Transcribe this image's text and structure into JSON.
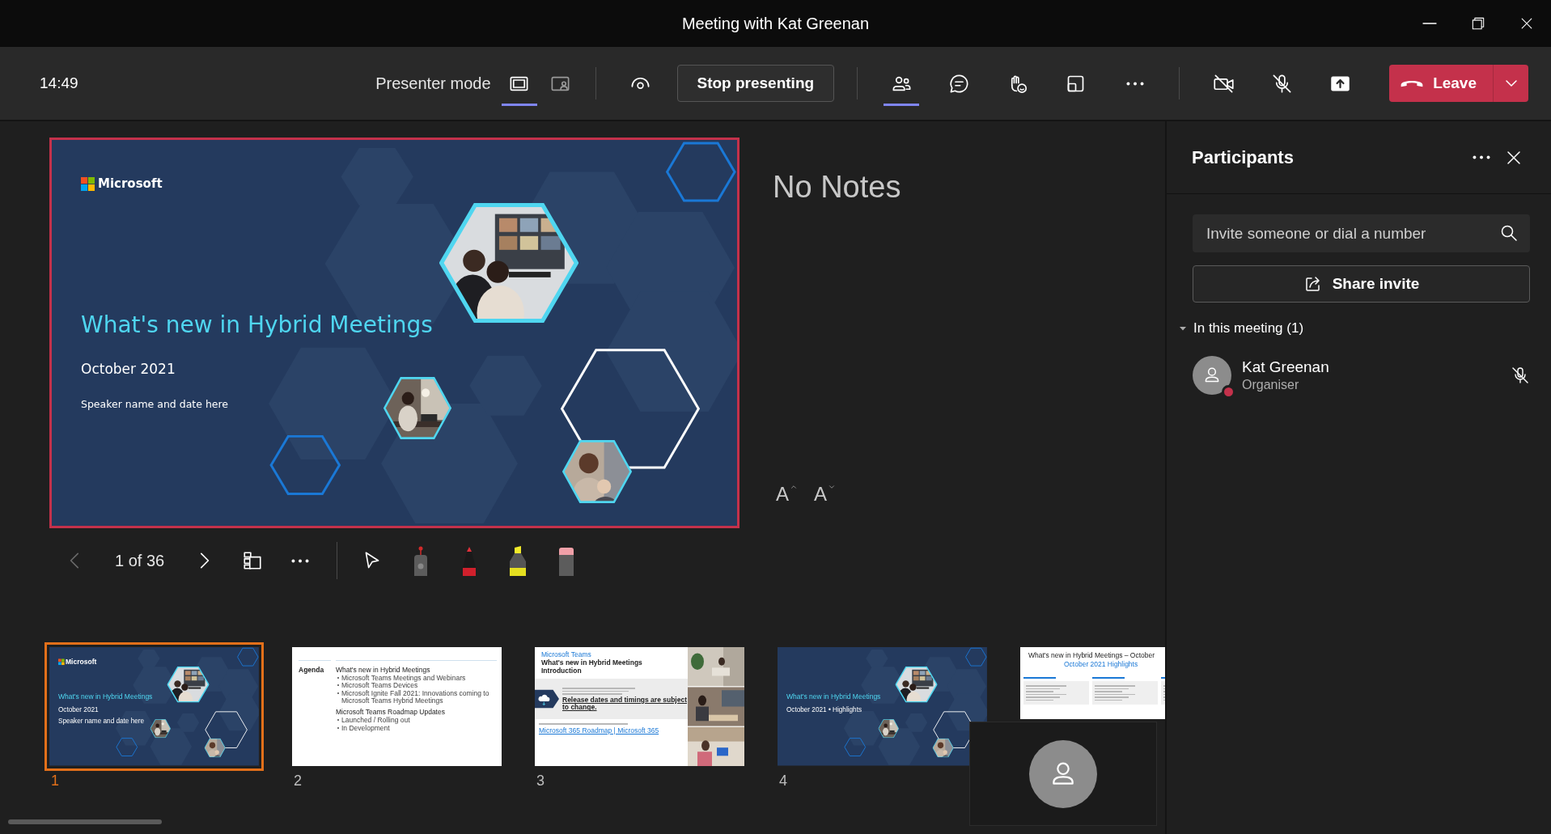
{
  "window": {
    "title": "Meeting with Kat Greenan"
  },
  "toolbar": {
    "time": "14:49",
    "presenter_mode": "Presenter mode",
    "views": [
      {
        "kind": "screen",
        "selected": true
      },
      {
        "kind": "overlay",
        "selected": false
      }
    ],
    "stop_presenting": "Stop presenting",
    "actions": [
      {
        "kind": "people",
        "selected": true
      },
      {
        "kind": "chat",
        "selected": false
      },
      {
        "kind": "react",
        "selected": false
      },
      {
        "kind": "rooms",
        "selected": false
      },
      {
        "kind": "more",
        "selected": false
      }
    ],
    "devices": [
      {
        "kind": "camera",
        "on": false
      },
      {
        "kind": "mic",
        "on": false
      },
      {
        "kind": "share",
        "on": true
      }
    ],
    "leave": "Leave"
  },
  "slide": {
    "logo": "Microsoft",
    "title": "What's new in Hybrid Meetings",
    "date": "October 2021",
    "speaker": "Speaker name and date here"
  },
  "notes": {
    "text": "No Notes",
    "font_buttons": [
      {
        "label": "A",
        "kind": "increase"
      },
      {
        "label": "A",
        "kind": "decrease"
      }
    ]
  },
  "slide_controls": {
    "page": "1 of 36",
    "nav": [
      {
        "kind": "prev",
        "disabled": true
      },
      {
        "kind": "next",
        "disabled": false
      }
    ],
    "tools": [
      {
        "kind": "pointer"
      },
      {
        "kind": "laser"
      },
      {
        "kind": "pen"
      },
      {
        "kind": "highlighter"
      },
      {
        "kind": "eraser"
      }
    ]
  },
  "thumbnails": [
    {
      "number": "1",
      "selected": true,
      "kind": "title",
      "logo": "Microsoft",
      "title": "What's new in Hybrid Meetings",
      "date": "October 2021",
      "speaker": "Speaker name and date here"
    },
    {
      "number": "2",
      "selected": false,
      "kind": "agenda",
      "heading": "Agenda",
      "sections": [
        {
          "title": "What's new in Hybrid Meetings",
          "items": [
            "Microsoft Teams Meetings and Webinars",
            "Microsoft Teams Devices",
            "Microsoft Ignite Fall 2021: Innovations coming to Microsoft Teams Hybrid Meetings"
          ]
        },
        {
          "title": "Microsoft Teams Roadmap Updates",
          "items": [
            "Launched / Rolling out",
            "In Development"
          ]
        }
      ]
    },
    {
      "number": "3",
      "selected": false,
      "kind": "intro",
      "label": "Microsoft Teams",
      "title": "What's new in Hybrid Meetings",
      "subtitle": "Introduction",
      "note": "Release dates and timings are subject to change.",
      "link": "Microsoft 365 Roadmap | Microsoft 365"
    },
    {
      "number": "4",
      "selected": false,
      "kind": "title",
      "title": "What's new in Hybrid Meetings",
      "date": "October 2021 • Highlights"
    },
    {
      "selected": false,
      "kind": "summary",
      "title": "What's new in Hybrid Meetings – October",
      "subtitle": "October 2021 Highlights"
    }
  ],
  "participants_panel": {
    "title": "Participants",
    "search": {
      "placeholder": "Invite someone or dial a number"
    },
    "share_invite": "Share invite",
    "section": {
      "label": "In this meeting (1)",
      "expanded": true,
      "people": [
        {
          "name": "Kat Greenan",
          "role": "Organiser",
          "muted": true
        }
      ]
    }
  }
}
